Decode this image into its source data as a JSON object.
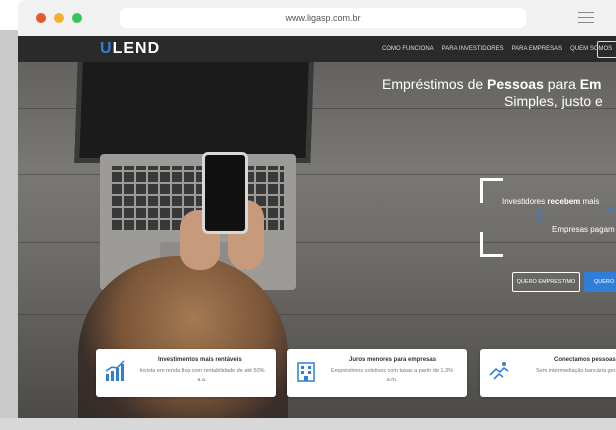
{
  "browser": {
    "url": "www.ligasp.com.br"
  },
  "site": {
    "logo": {
      "first": "U",
      "rest": "LEND"
    },
    "nav": [
      "COMO FUNCIONA",
      "PARA INVESTIDORES",
      "PARA EMPRESAS",
      "QUEM SOMOS"
    ]
  },
  "hero": {
    "title_prefix": "Empréstimos de ",
    "title_bold": "Pessoas",
    "title_mid": " para ",
    "title_bold2": "Em",
    "subtitle": "Simples, justo e",
    "feature_1_prefix": "Investidores ",
    "feature_1_bold": "recebem",
    "feature_1_suffix": " mais",
    "feature_2": "Empresas pagam",
    "btn_investor": "QUERO EMPRESTIMO",
    "btn_borrow": "QUERO C"
  },
  "cards": [
    {
      "title": "Investimentos mais rentáveis",
      "text": "Invista em renda fixa com rentabilidade de até 50% a.a."
    },
    {
      "title": "Juros menores para empresas",
      "text": "Empréstimos coletivos com taxas a partir de 1,3% a.m."
    },
    {
      "title": "Conectamos pessoas",
      "text": "Sem intermediação bancária gera valor"
    }
  ],
  "colors": {
    "accent": "#2f7ed8",
    "navbar": "#2a2a2a"
  }
}
